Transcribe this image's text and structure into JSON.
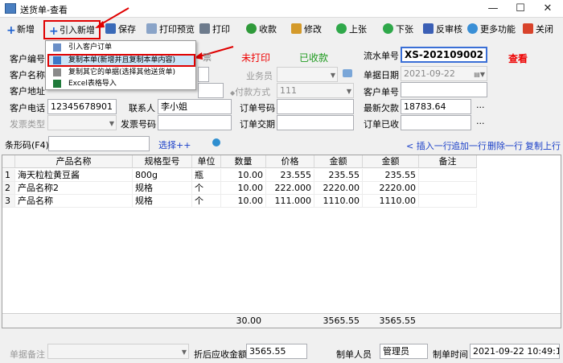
{
  "window": {
    "title": "送货单-查看",
    "minimize": "—",
    "maximize": "☐",
    "close": "✕"
  },
  "toolbar": {
    "new": "新增",
    "import_new": "引入新增",
    "save": "保存",
    "print_preview": "打印预览",
    "print": "打印",
    "receive": "收款",
    "modify": "修改",
    "prev": "上张",
    "next": "下张",
    "unaudit": "反审核",
    "more": "更多功能",
    "close": "关闭"
  },
  "popup_menu": [
    {
      "label": "引入客户订单"
    },
    {
      "label": "复制本单(新增并且复制本单内容)"
    },
    {
      "label": "复制其它的单据(选择其他送货单)"
    },
    {
      "label": "Excel表格导入"
    }
  ],
  "status": {
    "invoice_partial": "票",
    "not_printed": "未打印",
    "received": "已收款",
    "view_mode": "查看"
  },
  "form": {
    "customer_code_label": "客户编号",
    "customer_name_label": "客户名称",
    "customer_addr_label": "客户地址",
    "customer_phone_label": "客户电话",
    "customer_phone": "12345678901",
    "invoice_type_label": "发票类型",
    "contact_label": "联系人",
    "contact": "李小姐",
    "invoice_no_label": "发票号码",
    "salesman_label": "业务员",
    "payment_label": "付款方式",
    "payment": "111",
    "order_no_label": "订单号码",
    "order_date_label": "订单交期",
    "serial_label": "流水单号",
    "serial": "XS-202109002",
    "date_label": "单据日期",
    "date": "2021-09-22",
    "cust_order_label": "客户单号",
    "latest_debt_label": "最新欠款",
    "latest_debt": "18783.64",
    "order_received_label": "订单已收",
    "ellipsis": "..."
  },
  "barcode": {
    "label": "条形码(F4)",
    "select": "选择++",
    "insert_row": "< 插入一行",
    "append_row": "追加一行",
    "delete_row": "删除一行",
    "copy_row": "复制上行"
  },
  "table": {
    "columns": [
      "",
      "产品名称",
      "规格型号",
      "单位",
      "数量",
      "价格",
      "金额",
      "金额",
      "备注"
    ],
    "rows": [
      [
        "1",
        "海天粒粒黄豆酱",
        "800g",
        "瓶",
        "10.00",
        "23.555",
        "235.55",
        "235.55",
        ""
      ],
      [
        "2",
        "产品名称2",
        "规格",
        "个",
        "10.00",
        "222.000",
        "2220.00",
        "2220.00",
        ""
      ],
      [
        "3",
        "产品名称",
        "规格",
        "个",
        "10.00",
        "111.000",
        "1110.00",
        "1110.00",
        ""
      ]
    ],
    "totals": {
      "qty": "30.00",
      "amount": "3565.55",
      "amount2": "3565.55"
    }
  },
  "footer": {
    "remark_label": "单据备注",
    "receivable_label": "折后应收金额",
    "receivable": "3565.55",
    "maker_label": "制单人员",
    "maker": "管理员",
    "make_time_label": "制单时间",
    "make_time": "2021-09-22 10:49:16"
  },
  "colors": {
    "annotation": "#e00000",
    "accent_blue": "#1a3fc8",
    "popup_highlight": "#cce4f7"
  }
}
